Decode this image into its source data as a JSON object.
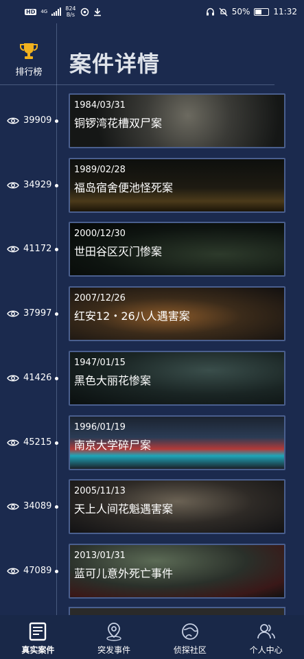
{
  "status_bar": {
    "hd": "HD",
    "network": "4G",
    "speed_value": "824",
    "speed_unit": "B/s",
    "battery": "50%",
    "time": "11:32"
  },
  "rank": {
    "label": "排行榜"
  },
  "page_title": "案件详情",
  "cases": [
    {
      "views": "39909",
      "date": "1984/03/31",
      "title": "铜锣湾花槽双尸案"
    },
    {
      "views": "34929",
      "date": "1989/02/28",
      "title": "福岛宿舍便池怪死案"
    },
    {
      "views": "41172",
      "date": "2000/12/30",
      "title": "世田谷区灭门惨案"
    },
    {
      "views": "37997",
      "date": "2007/12/26",
      "title": "红安12・26八人遇害案"
    },
    {
      "views": "41426",
      "date": "1947/01/15",
      "title": "黑色大丽花惨案"
    },
    {
      "views": "45215",
      "date": "1996/01/19",
      "title": "南京大学碎尸案"
    },
    {
      "views": "34089",
      "date": "2005/11/13",
      "title": "天上人间花魁遇害案"
    },
    {
      "views": "47089",
      "date": "2013/01/31",
      "title": "蓝可儿意外死亡事件"
    }
  ],
  "nav": [
    {
      "label": "真实案件",
      "icon": "document-icon",
      "active": true
    },
    {
      "label": "突发事件",
      "icon": "location-pin-icon",
      "active": false
    },
    {
      "label": "侦探社区",
      "icon": "community-icon",
      "active": false
    },
    {
      "label": "个人中心",
      "icon": "user-icon",
      "active": false
    }
  ],
  "colors": {
    "background": "#1b2a4e",
    "card_border": "#4a5f8e",
    "nav_bg": "#192848"
  }
}
